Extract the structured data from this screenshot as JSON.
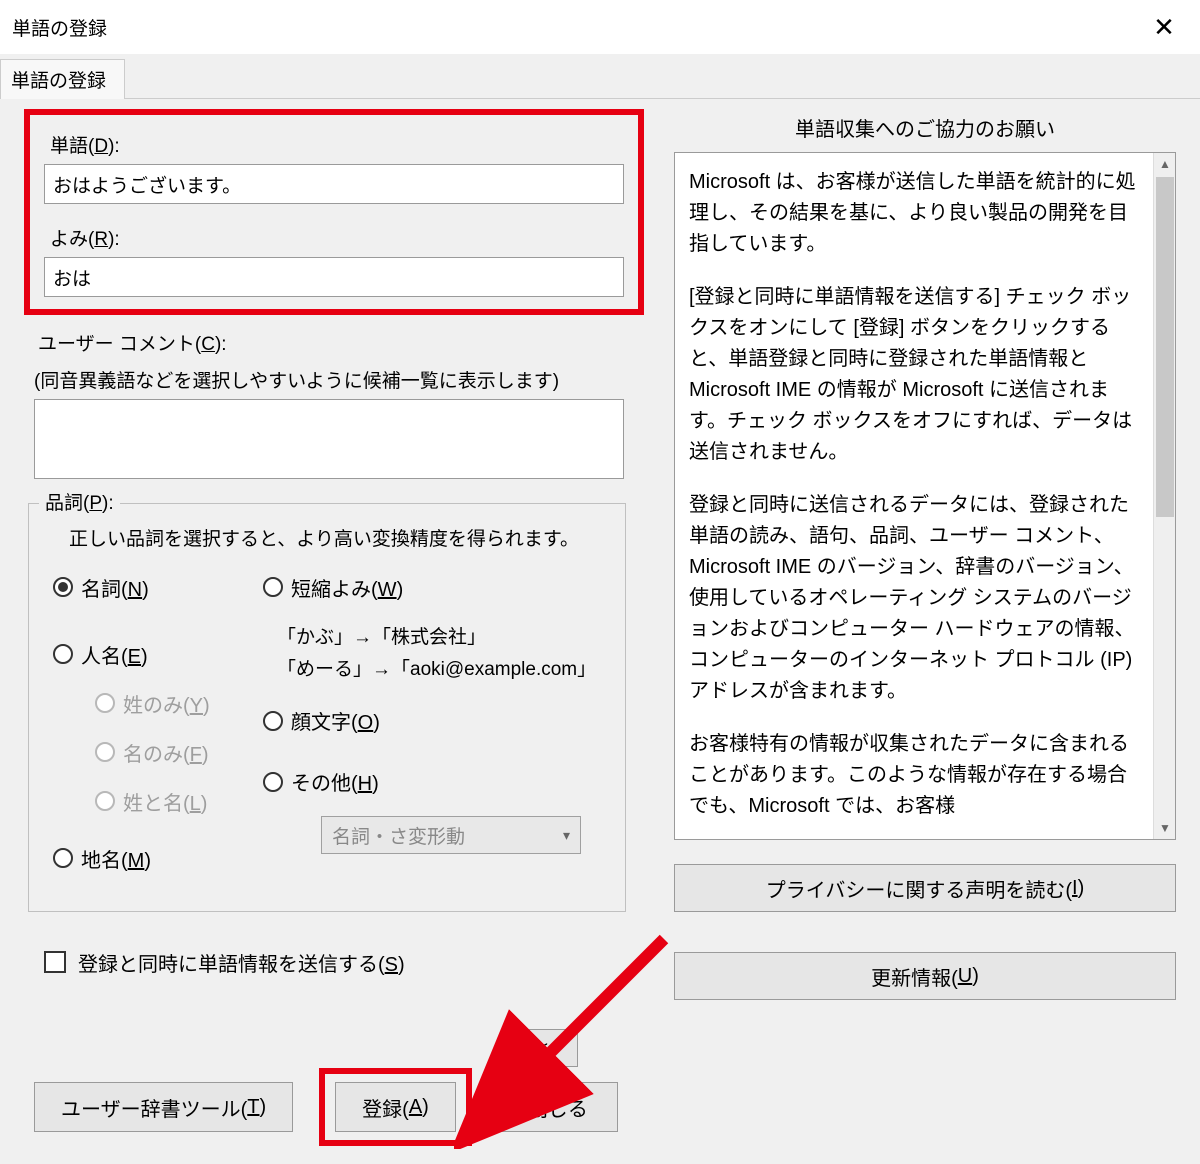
{
  "window": {
    "title": "単語の登録"
  },
  "tabs": [
    {
      "label": "単語の登録"
    }
  ],
  "left": {
    "word_label_pre": "単語(",
    "word_label_key": "D",
    "word_label_post": "):",
    "word_value": "おはようございます。",
    "reading_label_pre": "よみ(",
    "reading_label_key": "R",
    "reading_label_post": "):",
    "reading_value": "おは",
    "comment_label_pre": "ユーザー コメント(",
    "comment_label_key": "C",
    "comment_label_post": "):",
    "comment_help": "(同音異義語などを選択しやすいように候補一覧に表示します)",
    "comment_value": "",
    "pos": {
      "legend_pre": "品詞(",
      "legend_key": "P",
      "legend_post": "):",
      "desc": "正しい品詞を選択すると、より高い変換精度を得られます。",
      "noun_pre": "名詞(",
      "noun_key": "N",
      "noun_post": ")",
      "person_pre": "人名(",
      "person_key": "E",
      "person_post": ")",
      "surname_pre": "姓のみ(",
      "surname_key": "Y",
      "surname_post": ")",
      "given_pre": "名のみ(",
      "given_key": "F",
      "given_post": ")",
      "fullname_pre": "姓と名(",
      "fullname_key": "L",
      "fullname_post": ")",
      "place_pre": "地名(",
      "place_key": "M",
      "place_post": ")",
      "abbrev_pre": "短縮よみ(",
      "abbrev_key": "W",
      "abbrev_post": ")",
      "sample1": "「かぶ」→「株式会社」",
      "sample2": "「めーる」→「aoki@example.com」",
      "kaomoji_pre": "顔文字(",
      "kaomoji_key": "O",
      "kaomoji_post": ")",
      "other_pre": "その他(",
      "other_key": "H",
      "other_post": ")",
      "select_value": "名詞・さ変形動"
    },
    "send_checkbox_pre": "登録と同時に単語情報を送信する(",
    "send_checkbox_key": "S",
    "send_checkbox_post": ")",
    "collapse_btn": "<<"
  },
  "right": {
    "title": "単語収集へのご協力のお願い",
    "p1": "Microsoft は、お客様が送信した単語を統計的に処理し、その結果を基に、より良い製品の開発を目指しています。",
    "p2": "[登録と同時に単語情報を送信する] チェック ボックスをオンにして [登録] ボタンをクリックすると、単語登録と同時に登録された単語情報と Microsoft IME の情報が Microsoft に送信されます。チェック ボックスをオフにすれば、データは送信されません。",
    "p3": "登録と同時に送信されるデータには、登録された単語の読み、語句、品詞、ユーザー コメント、Microsoft IME のバージョン、辞書のバージョン、使用しているオペレーティング システムのバージョンおよびコンピューター ハードウェアの情報、コンピューターのインターネット プロトコル (IP) アドレスが含まれます。",
    "p4": "お客様特有の情報が収集されたデータに含まれることがあります。このような情報が存在する場合でも、Microsoft では、お客様",
    "privacy_pre": "プライバシーに関する声明を読む(",
    "privacy_key": "I",
    "privacy_post": ")",
    "update_pre": "更新情報(",
    "update_key": "U",
    "update_post": ")"
  },
  "buttons": {
    "dict_tool_pre": "ユーザー辞書ツール(",
    "dict_tool_key": "T",
    "dict_tool_post": ")",
    "register_pre": "登録(",
    "register_key": "A",
    "register_post": ")",
    "close": "閉じる"
  }
}
